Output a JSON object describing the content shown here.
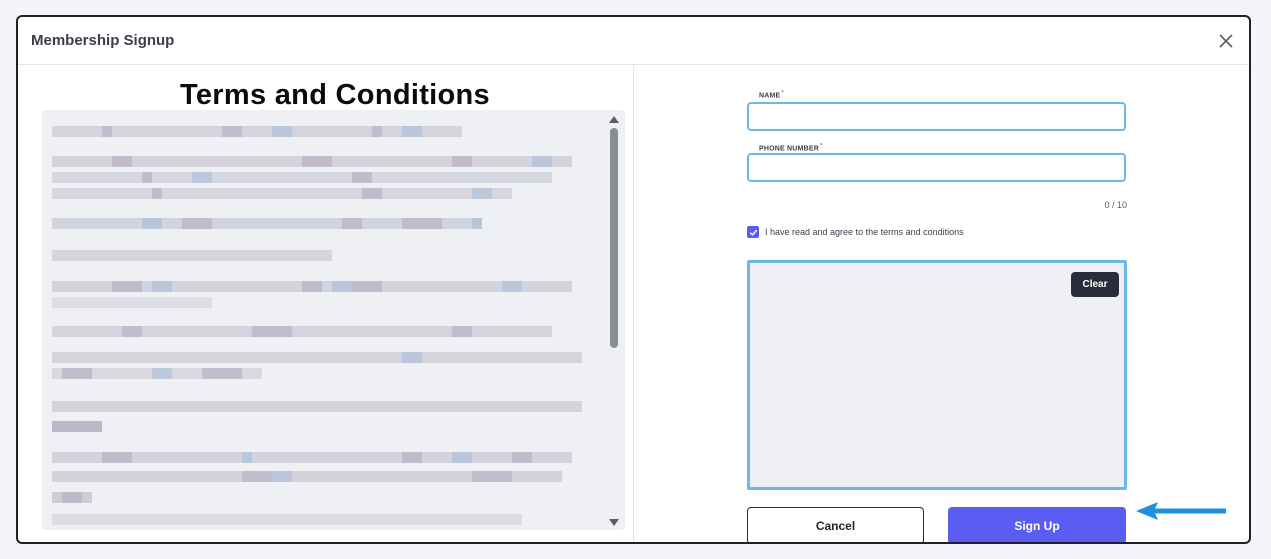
{
  "modal": {
    "title": "Membership Signup"
  },
  "terms": {
    "title": "Terms and Conditions"
  },
  "form": {
    "name_label": "NAME",
    "phone_label": "PHONE NUMBER",
    "required_mark": "*",
    "name_value": "",
    "phone_value": "",
    "phone_counter": "0 / 10",
    "agree_text": "I have read and agree to the terms and conditions",
    "agree_checked": true
  },
  "signature": {
    "clear_label": "Clear"
  },
  "actions": {
    "cancel_label": "Cancel",
    "signup_label": "Sign Up"
  },
  "colors": {
    "accent": "#5b5cf2",
    "input_border": "#6cb8e8",
    "arrow": "#1f8fe0"
  },
  "icons": {
    "close": "close-icon",
    "check": "check-icon",
    "arrow": "arrow-left-icon"
  }
}
